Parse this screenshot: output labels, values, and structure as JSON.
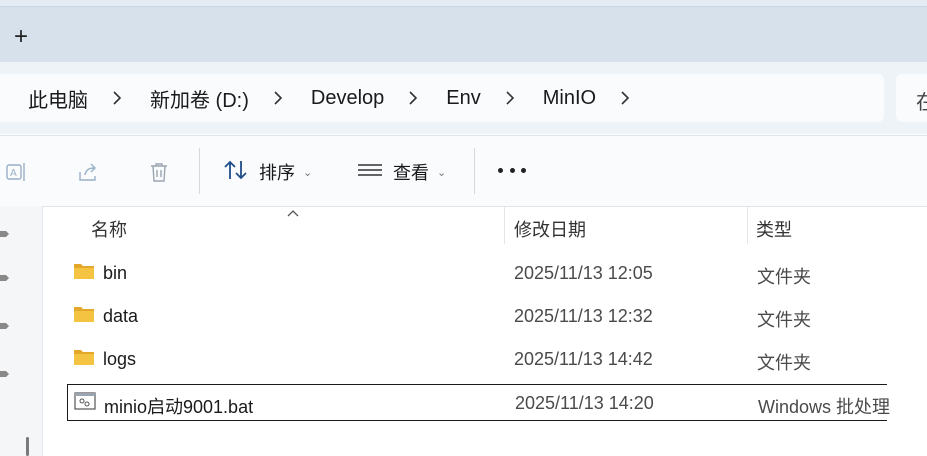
{
  "tabstrip": {
    "new_tab_label": "+"
  },
  "breadcrumbs": [
    {
      "label": "此电脑"
    },
    {
      "label": "新加卷 (D:)"
    },
    {
      "label": "Develop"
    },
    {
      "label": "Env"
    },
    {
      "label": "MinIO"
    }
  ],
  "search": {
    "placeholder_visible": "在"
  },
  "toolbar": {
    "sort_label": "排序",
    "view_label": "查看",
    "icons": [
      "rename-icon",
      "share-icon",
      "delete-icon",
      "sort-icon",
      "view-icon",
      "more-icon"
    ]
  },
  "columns": {
    "name": "名称",
    "modified": "修改日期",
    "type": "类型"
  },
  "files": [
    {
      "name": "bin",
      "modified": "2025/11/13 12:05",
      "type": "文件夹",
      "kind": "folder"
    },
    {
      "name": "data",
      "modified": "2025/11/13 12:32",
      "type": "文件夹",
      "kind": "folder"
    },
    {
      "name": "logs",
      "modified": "2025/11/13 14:42",
      "type": "文件夹",
      "kind": "folder"
    },
    {
      "name": "minio启动9001.bat",
      "modified": "2025/11/13 14:20",
      "type": "Windows 批处理",
      "kind": "batch",
      "selected": true
    }
  ],
  "colors": {
    "folder": "#f5c342",
    "folder_back": "#e3a72a",
    "tabstrip_bg": "#d6e1ec",
    "toolbar_bg": "#f9fbfd"
  }
}
